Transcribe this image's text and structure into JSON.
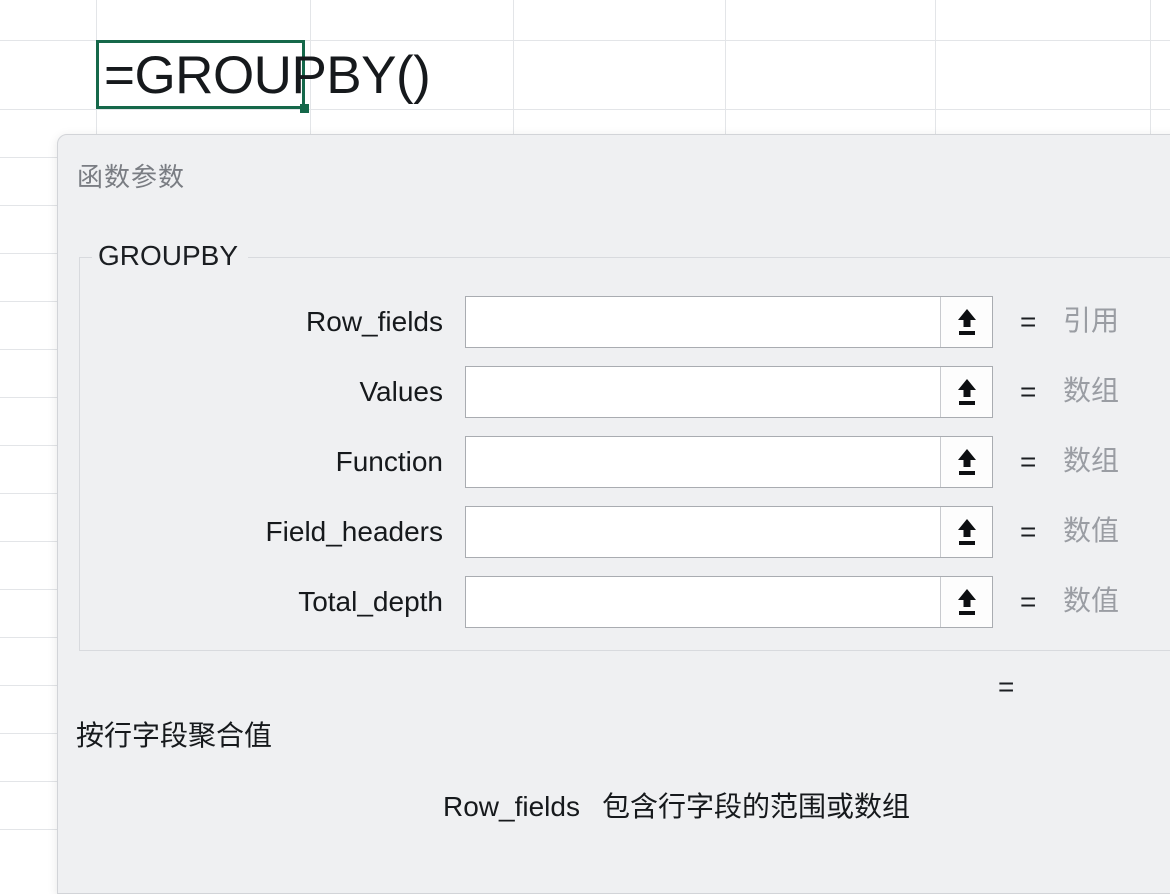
{
  "spreadsheet": {
    "active_cell": {
      "formula": "=GROUPBY()"
    },
    "column_boundaries": [
      96,
      310,
      513,
      725,
      935,
      1150
    ],
    "row_boundaries": [
      40,
      109,
      157,
      205,
      253,
      301,
      349,
      397,
      445,
      493,
      541,
      589,
      637,
      685,
      733,
      781,
      829
    ]
  },
  "dialog": {
    "title": "函数参数",
    "group_label": "GROUPBY",
    "arguments": [
      {
        "label": "Row_fields",
        "value": "",
        "placeholder": "",
        "equals": "=",
        "type": "引用",
        "icon": "collapse-range-icon"
      },
      {
        "label": "Values",
        "value": "",
        "placeholder": "",
        "equals": "=",
        "type": "数组",
        "icon": "collapse-range-icon"
      },
      {
        "label": "Function",
        "value": "",
        "placeholder": "",
        "equals": "=",
        "type": "数组",
        "icon": "collapse-range-icon"
      },
      {
        "label": "Field_headers",
        "value": "",
        "placeholder": "",
        "equals": "=",
        "type": "数值",
        "icon": "collapse-range-icon"
      },
      {
        "label": "Total_depth",
        "value": "",
        "placeholder": "",
        "equals": "=",
        "type": "数值",
        "icon": "collapse-range-icon"
      }
    ],
    "result": {
      "equals": "=",
      "value": ""
    },
    "function_description": "按行字段聚合值",
    "argument_help": {
      "name": "Row_fields",
      "text": "包含行字段的范围或数组"
    }
  },
  "colors": {
    "selection_green": "#15684a",
    "dialog_bg": "#eff0f2",
    "type_text_gray": "#9a9da3",
    "title_gray": "#7a7d83",
    "gridline": "#e3e5e8"
  }
}
